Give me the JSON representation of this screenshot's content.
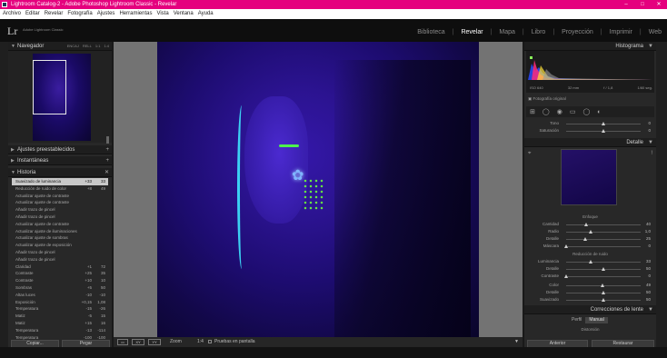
{
  "window": {
    "title": "Lightroom Catalog-2 - Adobe Photoshop Lightroom Classic - Revelar",
    "minimize": "–",
    "maximize": "□",
    "close": "✕"
  },
  "menu": [
    "Archivo",
    "Editar",
    "Revelar",
    "Fotografía",
    "Ajustes",
    "Herramientas",
    "Vista",
    "Ventana",
    "Ayuda"
  ],
  "identity": {
    "logo": "Lr",
    "catalog": "Adobe Lightroom Classic"
  },
  "modules": {
    "items": [
      "Biblioteca",
      "Revelar",
      "Mapa",
      "Libro",
      "Proyección",
      "Imprimir",
      "Web"
    ],
    "active": "Revelar",
    "sep": "|"
  },
  "left_panel": {
    "navigator": {
      "title": "Navegador",
      "opts": [
        "ENCAJ",
        "RELL",
        "1:1",
        "1:4"
      ],
      "plus": "◂"
    },
    "presets": {
      "title": "Ajustes preestablecidos",
      "plus": "+"
    },
    "snapshots": {
      "title": "Instantáneas",
      "plus": "+"
    },
    "history": {
      "title": "Historia",
      "clear": "✕",
      "items": [
        {
          "label": "Suavizado de luminancia",
          "v1": "+33",
          "v2": "33",
          "selected": true
        },
        {
          "label": "Reducción de ruido de color",
          "v1": "+8",
          "v2": "49"
        },
        {
          "label": "Actualizar ajuste de contraste",
          "v1": "",
          "v2": ""
        },
        {
          "label": "Actualizar ajuste de contraste",
          "v1": "",
          "v2": ""
        },
        {
          "label": "Añadir trazo de pincel",
          "v1": "",
          "v2": ""
        },
        {
          "label": "Añadir trazo de pincel",
          "v1": "",
          "v2": ""
        },
        {
          "label": "Actualizar ajuste de contraste",
          "v1": "",
          "v2": ""
        },
        {
          "label": "Actualizar ajuste de iluminaciones",
          "v1": "",
          "v2": ""
        },
        {
          "label": "Actualizar ajuste de sombras",
          "v1": "",
          "v2": ""
        },
        {
          "label": "Actualizar ajuste de exposición",
          "v1": "",
          "v2": ""
        },
        {
          "label": "Añadir trazo de pincel",
          "v1": "",
          "v2": ""
        },
        {
          "label": "Añadir trazo de pincel",
          "v1": "",
          "v2": ""
        },
        {
          "label": "Claridad",
          "v1": "+1",
          "v2": "72"
        },
        {
          "label": "Contraste",
          "v1": "+25",
          "v2": "35"
        },
        {
          "label": "Contraste",
          "v1": "+10",
          "v2": "10"
        },
        {
          "label": "Sombras",
          "v1": "+5",
          "v2": "50"
        },
        {
          "label": "Altas luces",
          "v1": "-10",
          "v2": "-10"
        },
        {
          "label": "Exposición",
          "v1": "+0,15",
          "v2": "1,08"
        },
        {
          "label": "Temperatura",
          "v1": "-15",
          "v2": "-26"
        },
        {
          "label": "Matiz",
          "v1": "-5",
          "v2": "15"
        },
        {
          "label": "Matiz",
          "v1": "+15",
          "v2": "16"
        },
        {
          "label": "Temperatura",
          "v1": "-13",
          "v2": "-114"
        },
        {
          "label": "Temperatura",
          "v1": "-100",
          "v2": "-100"
        }
      ]
    },
    "copy_button": "Copiar...",
    "paste_button": "Pegar"
  },
  "center_toolbar": {
    "zoom_label": "Zoom",
    "zoom_value": "1:4",
    "proof_label": "Pruebas en pantalla"
  },
  "right_panel": {
    "histogram": {
      "title": "Histograma",
      "iso": "ISO 640",
      "focal": "32 mm",
      "aperture": "f / 1,8",
      "shutter": "1/60 seg."
    },
    "original_label": "Fotografía original",
    "tone_rows": [
      {
        "label": "Tono",
        "value": "0",
        "pos": 0.5
      },
      {
        "label": "Saturación",
        "value": "0",
        "pos": 0.5
      }
    ],
    "detail": {
      "title": "Detalle",
      "sharpen_title": "Enfoque",
      "sharpen": [
        {
          "label": "Cantidad",
          "value": "40",
          "pos": 0.27
        },
        {
          "label": "Radio",
          "value": "1,0",
          "pos": 0.33
        },
        {
          "label": "Detalle",
          "value": "25",
          "pos": 0.25
        },
        {
          "label": "Máscara",
          "value": "0",
          "pos": 0.0
        }
      ],
      "noise_title": "Reducción de ruido",
      "noise_lum": [
        {
          "label": "Luminancia",
          "value": "33",
          "pos": 0.33
        },
        {
          "label": "Detalle",
          "value": "50",
          "pos": 0.5
        },
        {
          "label": "Contraste",
          "value": "0",
          "pos": 0.0
        }
      ],
      "noise_color": [
        {
          "label": "Color",
          "value": "49",
          "pos": 0.49
        },
        {
          "label": "Detalle",
          "value": "50",
          "pos": 0.5
        },
        {
          "label": "Suavizado",
          "value": "50",
          "pos": 0.5
        }
      ]
    },
    "lens": {
      "title": "Correcciones de lente",
      "tabs": [
        "Perfil",
        "Manual"
      ],
      "active": "Manual",
      "sub": "Distorsión"
    },
    "prev_button": "Anterior",
    "reset_button": "Restaurar"
  },
  "colors": {
    "titlebar": "#e5007e",
    "panel": "#282828",
    "photo_base": "#2b1390"
  }
}
